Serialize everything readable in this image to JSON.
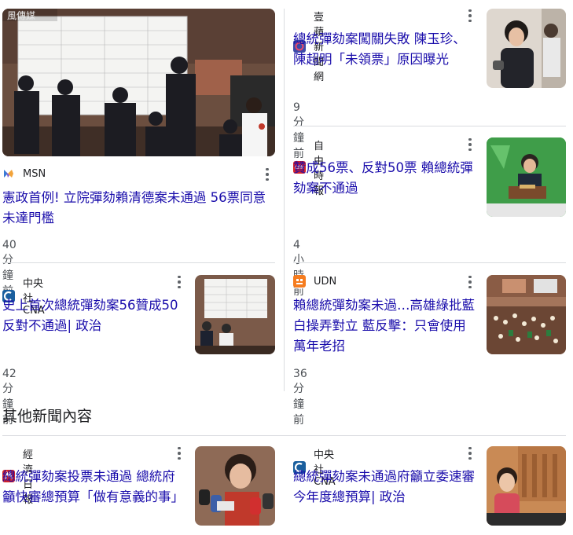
{
  "cards": [
    {
      "source": "MSN",
      "title": "憲政首例! 立院彈劾賴清德案未通過 56票同意未達門檻",
      "time": "40 分鐘前",
      "image_watermark": "風傳媒"
    },
    {
      "source": "壹蘋新聞網",
      "title": "總統彈劾案闖關失敗 陳玉珍、陳超明「未領票」原因曝光",
      "time": "9 分鐘前"
    },
    {
      "source": "自由時報",
      "title": "贊成56票、反對50票 賴總統彈劾案不通過",
      "time": "4 小時前",
      "favicon_text": "LTN"
    },
    {
      "source": "中央社 CNA",
      "title": "史上首次總統彈劾案56贊成50反對不通過| 政治",
      "time": "42 分鐘前"
    },
    {
      "source": "UDN",
      "title": "賴總統彈劾案未過…高雄綠批藍白操弄對立 藍反擊：只會使用萬年老招",
      "time": "36 分鐘前"
    }
  ],
  "section": {
    "title": "其他新聞內容"
  },
  "other_cards": [
    {
      "source": "經濟日報",
      "title": "總統彈劾案投票未通過 總統府籲快審總預算「做有意義的事」"
    },
    {
      "source": "中央社 CNA",
      "title": "總統彈劾案未通過府籲立委速審今年度總預算| 政治"
    }
  ],
  "colors": {
    "link": "#1a0dab",
    "text": "#202124",
    "meta": "#4d5156",
    "divider": "#dadce0"
  }
}
